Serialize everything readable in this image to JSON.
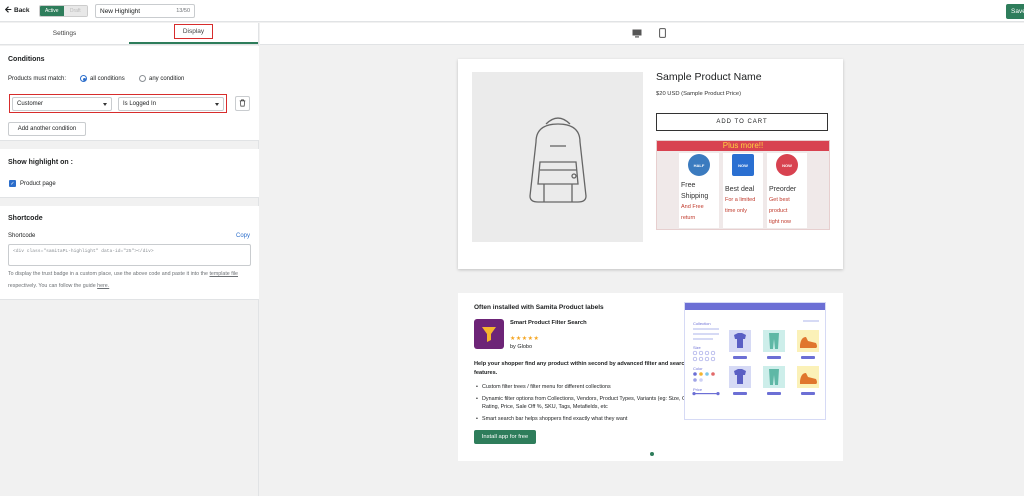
{
  "topbar": {
    "back_label": "Back",
    "status_active": "Active",
    "status_draft": "Draft",
    "title_value": "New Highlight",
    "title_count": "13/50",
    "save_label": "Save"
  },
  "tabs": [
    {
      "label": "Settings"
    },
    {
      "label": "Display"
    }
  ],
  "conditions": {
    "heading": "Conditions",
    "match_label": "Products must match:",
    "option_all": "all conditions",
    "option_any": "any condition",
    "field_value": "Customer",
    "operator_value": "Is Logged In",
    "add_label": "Add another condition"
  },
  "show_on": {
    "heading": "Show highlight on :",
    "product_page_label": "Product page"
  },
  "shortcode": {
    "heading": "Shortcode",
    "label": "Shortcode",
    "copy_label": "Copy",
    "code": "<div class=\"samitaPL-highlight\" data-id=\"25\"></div>",
    "hint_1": "To display the trust badge in a custom place, use the above code and paste it into the",
    "hint_link_1": "template file",
    "hint_2": "respectively. You can follow the guide",
    "hint_link_2": "here."
  },
  "preview": {
    "product_name": "Sample Product Name",
    "price": "$20 USD (Sample Product Price)",
    "add_to_cart": "ADD TO CART",
    "badges_title": "Plus more!!",
    "badges": [
      {
        "icon_text": "HALF",
        "title_1": "Free",
        "title_2": "Shipping",
        "sub_1": "And Free",
        "sub_2": "return",
        "color": "#3b7bbf"
      },
      {
        "icon_text": "NOW",
        "title_1": "Best deal",
        "title_2": "",
        "sub_1": "For a limited",
        "sub_2": "time only",
        "color": "#2a6fd1"
      },
      {
        "icon_text": "NOW",
        "title_1": "Preorder",
        "title_2": "",
        "sub_1": "Get best",
        "sub_2": "product",
        "sub_3": "tight now",
        "color": "#d84250"
      }
    ]
  },
  "app_promo": {
    "heading": "Often installed with Samita Product labels",
    "app_name": "Smart Product Filter Search",
    "stars": "★★★★★",
    "by": "by Globo",
    "description": "Help your shopper find any product within second by advanced filter and search features.",
    "bullets": [
      "Custom filter trees / filter menu for different collections",
      "Dynamic filter options from Collections, Vendors, Product Types, Variants (eg: Size, Color), Rating, Price, Sale Off %, SKU, Tags, Metafields, etc",
      "Smart search bar helps shoppers find exactly what they want"
    ],
    "install_label": "Install app for free",
    "mock_labels": {
      "collection": "Collection",
      "size": "Size",
      "color": "Color",
      "price": "Price"
    }
  },
  "colors": {
    "accent": "#2e7d5b",
    "highlight": "#d72c2c",
    "link": "#2c6ecb"
  }
}
